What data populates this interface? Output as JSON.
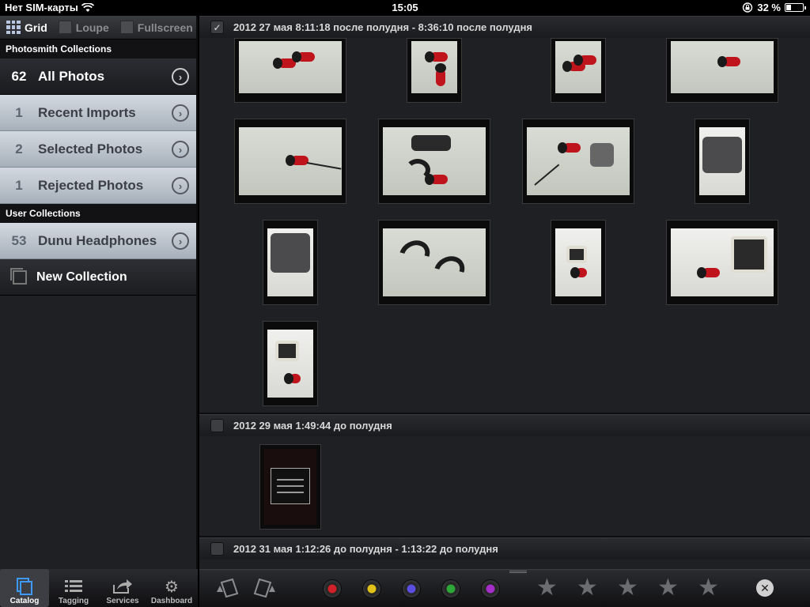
{
  "status_bar": {
    "carrier": "Нет SIM-карты",
    "time": "15:05",
    "battery": "32 %",
    "battery_fraction": 0.32
  },
  "view_modes": [
    {
      "label": "Grid",
      "selected": true,
      "icon": "grid-icon"
    },
    {
      "label": "Loupe",
      "selected": false,
      "icon": "loupe-icon"
    },
    {
      "label": "Fullscreen",
      "selected": false,
      "icon": "fullscreen-icon"
    }
  ],
  "sidebar": {
    "photosmith_header": "Photosmith Collections",
    "photosmith_collections": [
      {
        "count": "62",
        "label": "All Photos",
        "style": "dark"
      },
      {
        "count": "1",
        "label": "Recent Imports",
        "style": "light"
      },
      {
        "count": "2",
        "label": "Selected Photos",
        "style": "light"
      },
      {
        "count": "1",
        "label": "Rejected Photos",
        "style": "light"
      }
    ],
    "user_header": "User Collections",
    "user_collections": [
      {
        "count": "53",
        "label": "Dunu Headphones",
        "style": "light"
      }
    ],
    "new_collection": "New Collection"
  },
  "tabs": [
    {
      "label": "Catalog",
      "icon": "catalog-icon",
      "active": true
    },
    {
      "label": "Tagging",
      "icon": "list-icon",
      "active": false
    },
    {
      "label": "Services",
      "icon": "share-icon",
      "active": false
    },
    {
      "label": "Dashboard",
      "icon": "gear-icon",
      "active": false
    }
  ],
  "groups": [
    {
      "title": "2012 27 мая 8:11:18 после полудня - 8:36:10 после полудня",
      "checked": true
    },
    {
      "title": "2012 29 мая 1:49:44 до полудня",
      "checked": false
    },
    {
      "title": "2012 31 мая 1:12:26 до полудня - 1:13:22 до полудня",
      "checked": false
    }
  ],
  "toolbar": {
    "rotate_left_icon": "rotate-left-icon",
    "rotate_right_icon": "rotate-right-icon",
    "color_labels": [
      "#d0202a",
      "#e0c21a",
      "#5a4fe0",
      "#2fa83a",
      "#a52fc8"
    ],
    "star_count": 5,
    "clear_icon": "clear-rating-icon"
  }
}
